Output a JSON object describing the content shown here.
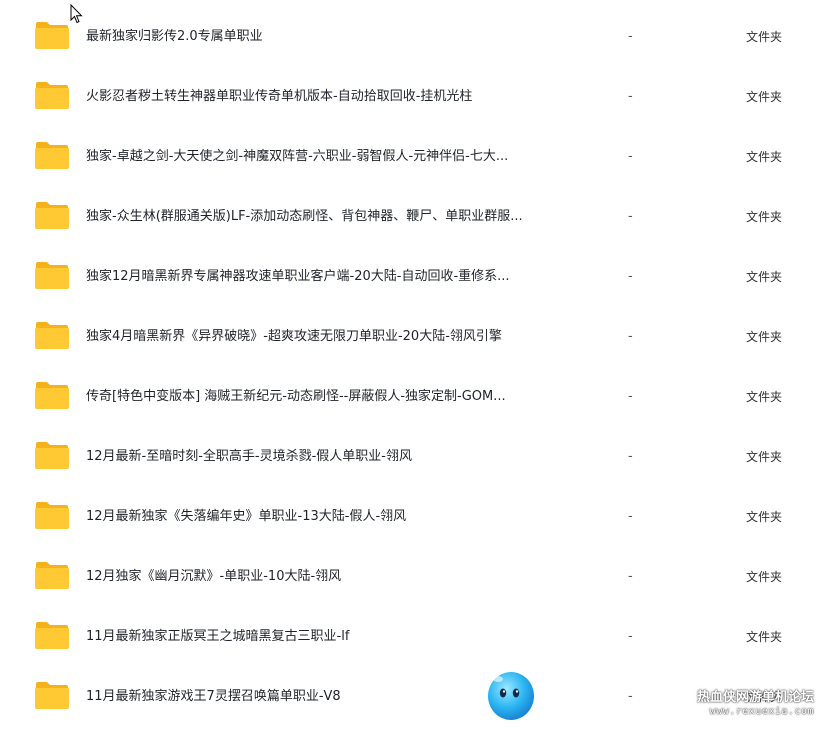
{
  "files": [
    {
      "name": "最新独家归影传2.0专属单职业",
      "size": "-",
      "type": "文件夹"
    },
    {
      "name": "火影忍者秽土转生神器单职业传奇单机版本-自动拾取回收-挂机光柱",
      "size": "-",
      "type": "文件夹"
    },
    {
      "name": "独家-卓越之剑-大天使之剑-神魔双阵营-六职业-弱智假人-元神伴侣-七大...",
      "size": "-",
      "type": "文件夹"
    },
    {
      "name": "独家-众生林(群服通关版)LF-添加动态刷怪、背包神器、鞭尸、单职业群服...",
      "size": "-",
      "type": "文件夹"
    },
    {
      "name": "独家12月暗黑新界专属神器攻速单职业客户端-20大陆-自动回收-重修系...",
      "size": "-",
      "type": "文件夹"
    },
    {
      "name": "独家4月暗黑新界《异界破晓》-超爽攻速无限刀单职业-20大陆-翎风引擎",
      "size": "-",
      "type": "文件夹"
    },
    {
      "name": "传奇[特色中变版本] 海贼王新纪元-动态刷怪--屏蔽假人-独家定制-GOM...",
      "size": "-",
      "type": "文件夹"
    },
    {
      "name": "12月最新-至暗时刻-全职高手-灵境杀戮-假人单职业-翎风",
      "size": "-",
      "type": "文件夹"
    },
    {
      "name": "12月最新独家《失落编年史》单职业-13大陆-假人-翎风",
      "size": "-",
      "type": "文件夹"
    },
    {
      "name": "12月独家《幽月沉默》-单职业-10大陆-翎风",
      "size": "-",
      "type": "文件夹"
    },
    {
      "name": "11月最新独家正版冥王之城暗黑复古三职业-lf",
      "size": "-",
      "type": "文件夹"
    },
    {
      "name": "11月最新独家游戏王7灵摆召唤篇单职业-V8",
      "size": "-",
      "type": "文件夹"
    }
  ],
  "watermark": {
    "line1": "热血侠网游单机论坛",
    "line2": "www.rexuexia.com"
  },
  "colors": {
    "folder_body": "#FFC933",
    "folder_tab": "#F5B21D",
    "text": "#1f2329"
  },
  "icons": {
    "folder": "folder-icon",
    "cursor": "mouse-pointer-icon",
    "mascot": "mascot-icon"
  }
}
